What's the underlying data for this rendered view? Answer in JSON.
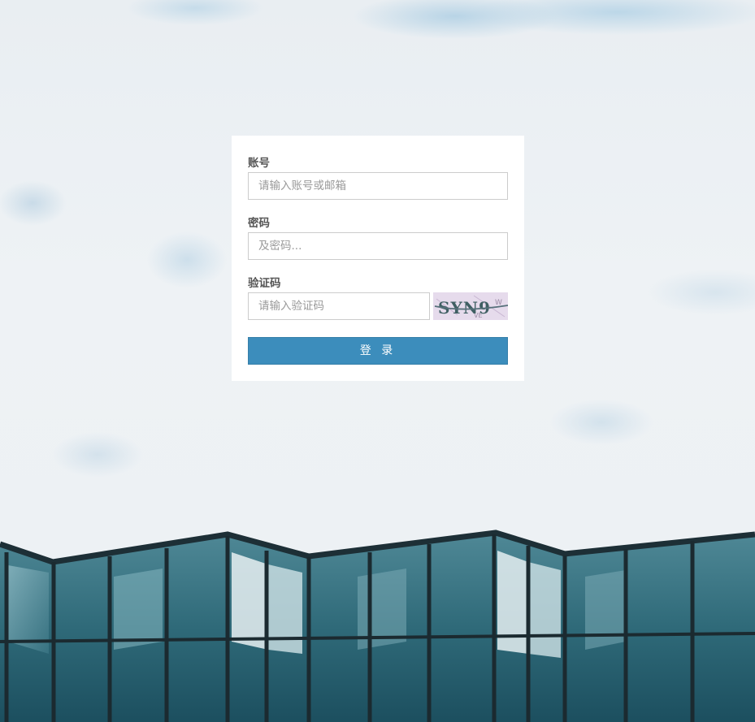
{
  "login": {
    "account_label": "账号",
    "account_placeholder": "请输入账号或邮箱",
    "password_label": "密码",
    "password_placeholder": "及密码...",
    "captcha_label": "验证码",
    "captcha_placeholder": "请输入验证码",
    "captcha_text": "SYN9",
    "captcha_noise": "W",
    "captcha_noise2": "VE",
    "submit_label": "登 录"
  },
  "colors": {
    "button_bg": "#3c8dbc",
    "card_bg": "#ffffff",
    "captcha_bg": "#e6dbec"
  },
  "icons": {
    "captcha": "captcha-image"
  }
}
